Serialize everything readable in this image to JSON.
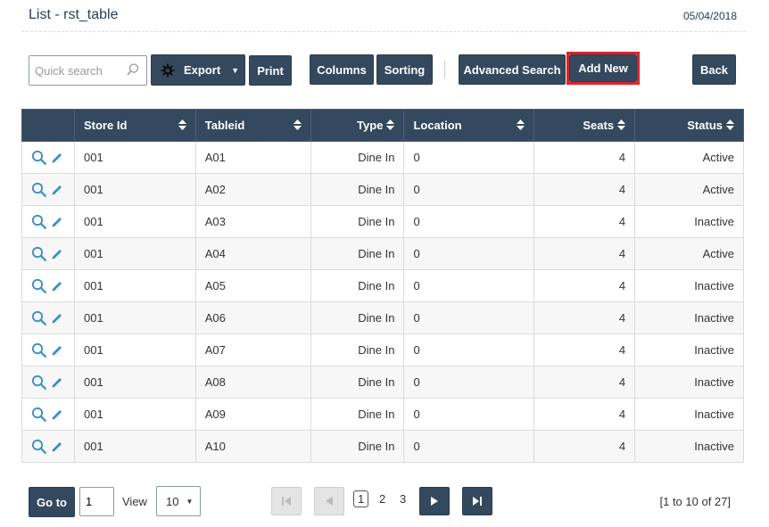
{
  "header": {
    "title": "List - rst_table",
    "date": "05/04/2018"
  },
  "toolbar": {
    "search_placeholder": "Quick search",
    "export_label": "Export",
    "print_label": "Print",
    "columns_label": "Columns",
    "sorting_label": "Sorting",
    "advanced_search_label": "Advanced Search",
    "add_new_label": "Add New",
    "back_label": "Back"
  },
  "table": {
    "columns": [
      "Store Id",
      "Tableid",
      "Type",
      "Location",
      "Seats",
      "Status"
    ],
    "rows": [
      {
        "store": "001",
        "tableid": "A01",
        "type": "Dine In",
        "location": "0",
        "seats": "4",
        "status": "Active"
      },
      {
        "store": "001",
        "tableid": "A02",
        "type": "Dine In",
        "location": "0",
        "seats": "4",
        "status": "Active"
      },
      {
        "store": "001",
        "tableid": "A03",
        "type": "Dine In",
        "location": "0",
        "seats": "4",
        "status": "Inactive"
      },
      {
        "store": "001",
        "tableid": "A04",
        "type": "Dine In",
        "location": "0",
        "seats": "4",
        "status": "Active"
      },
      {
        "store": "001",
        "tableid": "A05",
        "type": "Dine In",
        "location": "0",
        "seats": "4",
        "status": "Inactive"
      },
      {
        "store": "001",
        "tableid": "A06",
        "type": "Dine In",
        "location": "0",
        "seats": "4",
        "status": "Inactive"
      },
      {
        "store": "001",
        "tableid": "A07",
        "type": "Dine In",
        "location": "0",
        "seats": "4",
        "status": "Inactive"
      },
      {
        "store": "001",
        "tableid": "A08",
        "type": "Dine In",
        "location": "0",
        "seats": "4",
        "status": "Inactive"
      },
      {
        "store": "001",
        "tableid": "A09",
        "type": "Dine In",
        "location": "0",
        "seats": "4",
        "status": "Inactive"
      },
      {
        "store": "001",
        "tableid": "A10",
        "type": "Dine In",
        "location": "0",
        "seats": "4",
        "status": "Inactive"
      }
    ]
  },
  "pager": {
    "goto_label": "Go to",
    "page_value": "1",
    "view_label": "View",
    "view_value": "10",
    "pages": [
      "1",
      "2",
      "3"
    ],
    "range_text": "[1 to 10 of 27]"
  },
  "colors": {
    "primary": "#34495e",
    "highlight": "#e0202a",
    "icon": "#3a8fc4"
  }
}
